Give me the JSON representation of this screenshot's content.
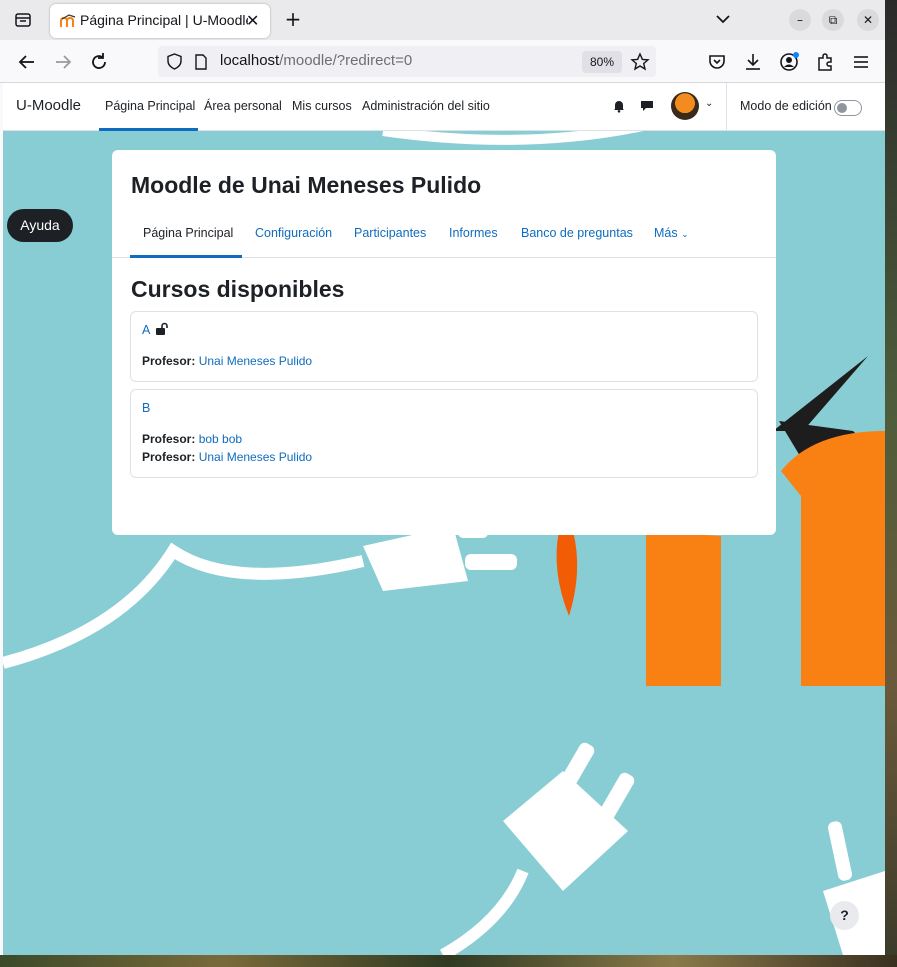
{
  "browser": {
    "tab_title": "Página Principal | U-Moodle",
    "url_host": "localhost",
    "url_path": "/moodle/?redirect=0",
    "zoom": "80%"
  },
  "header": {
    "brand": "U-Moodle",
    "nav": [
      "Página Principal",
      "Área personal",
      "Mis cursos",
      "Administración del sitio"
    ],
    "edit_mode_label": "Modo de edición"
  },
  "help_label": "Ayuda",
  "card": {
    "title": "Moodle de Unai Meneses Pulido",
    "tabs": [
      "Página Principal",
      "Configuración",
      "Participantes",
      "Informes",
      "Banco de preguntas",
      "Más"
    ],
    "section_title": "Cursos disponibles",
    "courses": [
      {
        "name": "A",
        "teachers": [
          {
            "label": "Profesor:",
            "name": "Unai Meneses Pulido"
          }
        ]
      },
      {
        "name": "B",
        "teachers": [
          {
            "label": "Profesor:",
            "name": "bob bob"
          },
          {
            "label": "Profesor:",
            "name": "Unai Meneses Pulido"
          }
        ]
      }
    ]
  },
  "help_button": "?",
  "colors": {
    "accent": "#0f6cbf",
    "background": "#89cdd4",
    "moodle_orange": "#f98012"
  }
}
